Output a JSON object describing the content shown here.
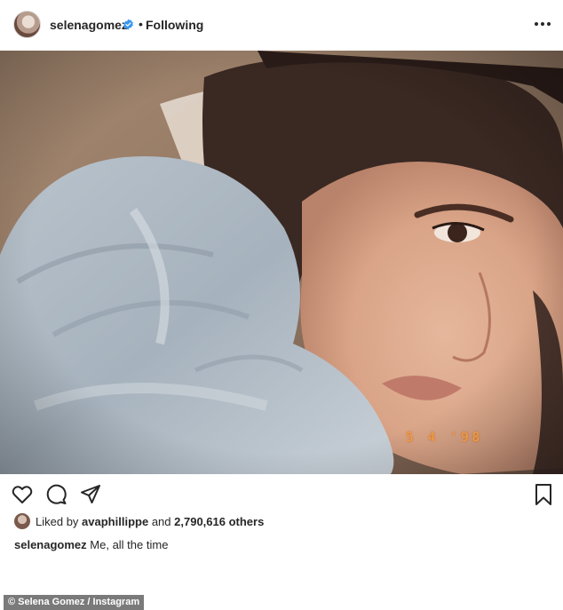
{
  "header": {
    "username": "selenagomez",
    "separator": "•",
    "follow_status": "Following",
    "more_icon": "more-options-icon",
    "verified_icon": "verified-badge-icon",
    "accent_color": "#3897f0"
  },
  "post": {
    "date_stamp": "5 4 '98"
  },
  "actions": {
    "like_icon": "heart-icon",
    "comment_icon": "comment-icon",
    "share_icon": "share-icon",
    "save_icon": "bookmark-icon"
  },
  "likes": {
    "prefix": "Liked by",
    "user": "avaphillippe",
    "middle": "and",
    "count": "2,790,616 others"
  },
  "caption": {
    "username": "selenagomez",
    "text": "Me, all the time"
  },
  "credit": "© Selena Gomez / Instagram"
}
